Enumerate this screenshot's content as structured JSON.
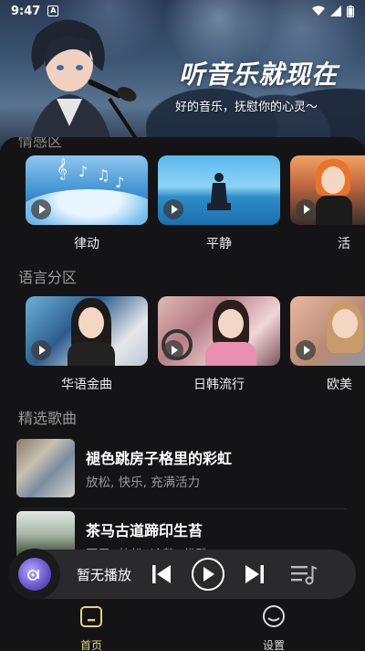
{
  "status_bar": {
    "time": "9:47",
    "notification_icon": "A"
  },
  "hero": {
    "title": "听音乐就现在",
    "subtitle": "好的音乐，抚慰你的心灵～"
  },
  "mood_section": {
    "title_partial": "情感区",
    "cards": [
      {
        "label": "律动"
      },
      {
        "label": "平静"
      },
      {
        "label": "活"
      }
    ]
  },
  "language_section": {
    "title": "语言分区",
    "cards": [
      {
        "label": "华语金曲"
      },
      {
        "label": "日韩流行"
      },
      {
        "label": "欧美"
      }
    ]
  },
  "featured_section": {
    "title": "精选歌曲",
    "songs": [
      {
        "title": "褪色跳房子格里的彩虹",
        "tags": "放松, 快乐, 充满活力"
      },
      {
        "title": "茶马古道蹄印生苔",
        "tags": "国风, 放松, 冷静, 优雅"
      }
    ]
  },
  "player": {
    "status": "暂无播放"
  },
  "bottom_nav": {
    "home_label": "首页",
    "settings_label": "设置"
  },
  "colors": {
    "accent": "#e6d27a",
    "panel": "#141416"
  }
}
